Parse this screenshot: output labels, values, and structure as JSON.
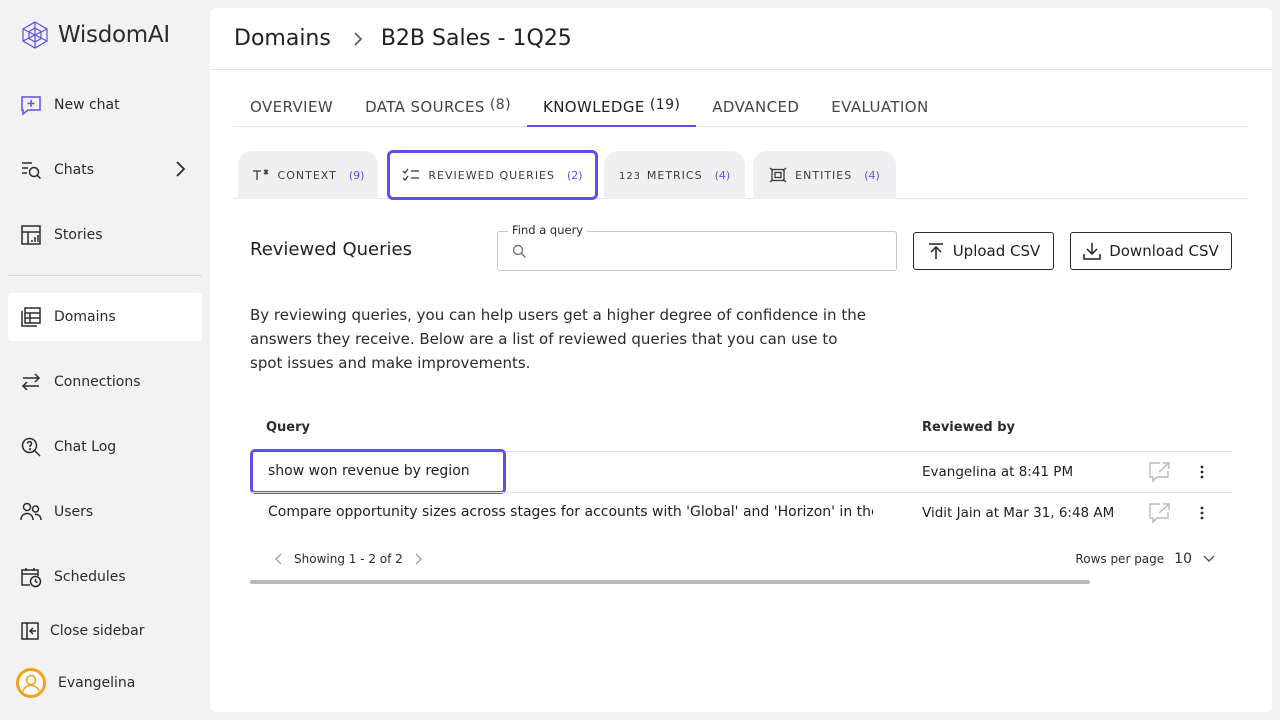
{
  "app": {
    "name": "WisdomAI"
  },
  "sidebar": {
    "items": [
      {
        "label": "New chat",
        "icon": "new-chat-icon"
      },
      {
        "label": "Chats",
        "icon": "chats-icon"
      },
      {
        "label": "Stories",
        "icon": "stories-icon"
      },
      {
        "label": "Domains",
        "icon": "domains-icon"
      },
      {
        "label": "Connections",
        "icon": "connections-icon"
      },
      {
        "label": "Chat Log",
        "icon": "chat-log-icon"
      },
      {
        "label": "Users",
        "icon": "users-icon"
      },
      {
        "label": "Schedules",
        "icon": "schedules-icon"
      },
      {
        "label": "Close sidebar",
        "icon": "close-sidebar-icon"
      }
    ],
    "active": "Domains",
    "user": {
      "name": "Evangelina"
    }
  },
  "breadcrumb": {
    "root": "Domains",
    "current": "B2B Sales - 1Q25"
  },
  "top_tabs": [
    {
      "label": "OVERVIEW",
      "count": ""
    },
    {
      "label": "DATA SOURCES",
      "count": "(8)"
    },
    {
      "label": "KNOWLEDGE",
      "count": "(19)"
    },
    {
      "label": "ADVANCED",
      "count": ""
    },
    {
      "label": "EVALUATION",
      "count": ""
    }
  ],
  "active_top_tab": "KNOWLEDGE",
  "sub_tabs": [
    {
      "label": "CONTEXT",
      "count": "(9)",
      "icon": "text-icon"
    },
    {
      "label": "REVIEWED QUERIES",
      "count": "(2)",
      "icon": "checklist-icon"
    },
    {
      "label": "METRICS",
      "count": "(4)",
      "icon": "numbers-icon"
    },
    {
      "label": "ENTITIES",
      "count": "(4)",
      "icon": "entity-icon"
    }
  ],
  "active_sub_tab": "REVIEWED QUERIES",
  "section": {
    "title": "Reviewed Queries",
    "search_label": "Find a query",
    "search_value": "",
    "upload_label": "Upload CSV",
    "download_label": "Download CSV",
    "description": "By reviewing queries, you can help users get a higher degree of confidence in the answers they receive. Below are a list of reviewed queries that you can use to spot issues and make improvements."
  },
  "table": {
    "headers": {
      "query": "Query",
      "reviewed_by": "Reviewed by"
    },
    "rows": [
      {
        "query": "show won revenue by region",
        "reviewed_by": "Evangelina at 8:41 PM"
      },
      {
        "query": "Compare opportunity sizes across stages for accounts with 'Global' and 'Horizon' in their names",
        "reviewed_by": "Vidit Jain at Mar 31, 6:48 AM"
      }
    ],
    "pagination": "Showing 1 - 2 of 2",
    "rows_per_page_label": "Rows per page",
    "rows_per_page_value": "10"
  },
  "colors": {
    "accent": "#5b52e8",
    "highlight": "#5a51e6",
    "avatar": "#f3a21d"
  }
}
